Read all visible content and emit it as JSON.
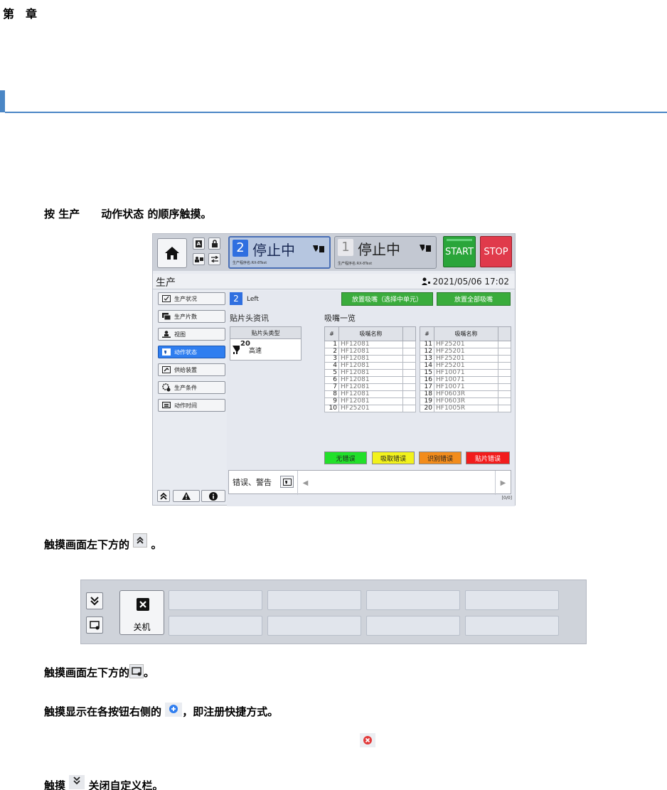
{
  "doc": {
    "chapter_a": "第",
    "chapter_b": "章",
    "step1_a": "按",
    "step1_b": "生产",
    "step1_c": "动作状态",
    "step1_d": "的顺序触摸。",
    "step2_a": "触摸画面左下方的",
    "step2_b": "。",
    "step3_a": "触摸画面左下方的",
    "step3_b": "。",
    "step4_a": "触摸显示在各按钮右侧的",
    "step4_b": "，即注册快捷方式。",
    "step5_a": "触摸",
    "step5_b": "关闭自定义栏。"
  },
  "screen": {
    "lane2_number": "2",
    "lane2_status": "停止中",
    "lane2_program": "生产程序名:RX-8Test",
    "lane1_number": "1",
    "lane1_status": "停止中",
    "lane1_program": "生产程序名:RX-8Test",
    "start_label": "START",
    "stop_label": "STOP",
    "page_title": "生产",
    "clock": "2021/05/06 17:02",
    "sidebar": [
      {
        "label": "生产状况",
        "icon": "checkbox-icon"
      },
      {
        "label": "生产片数",
        "icon": "boards-icon"
      },
      {
        "label": "视图",
        "icon": "person-view-icon"
      },
      {
        "label": "动作状态",
        "icon": "action-status-icon"
      },
      {
        "label": "供给装置",
        "icon": "feeder-icon"
      },
      {
        "label": "生产条件",
        "icon": "gear-icon"
      },
      {
        "label": "动作时间",
        "icon": "timer-icon"
      }
    ],
    "left_badge": "2",
    "left_label": "Left",
    "btn_release_selected": "放置吸嘴（选择中单元）",
    "btn_release_all": "放置全部吸嘴",
    "head_info_title": "贴片头资讯",
    "head_type_header": "贴片头类型",
    "head_type_number": "20",
    "head_type_value": "高速",
    "nozzle_list_title": "吸嘴一览",
    "col_hash": "#",
    "col_name": "吸嘴名称",
    "nozzles_left": [
      {
        "idx": "1",
        "name": "HF12081"
      },
      {
        "idx": "2",
        "name": "HF12081"
      },
      {
        "idx": "3",
        "name": "HF12081"
      },
      {
        "idx": "4",
        "name": "HF12081"
      },
      {
        "idx": "5",
        "name": "HF12081"
      },
      {
        "idx": "6",
        "name": "HF12081"
      },
      {
        "idx": "7",
        "name": "HF12081"
      },
      {
        "idx": "8",
        "name": "HF12081"
      },
      {
        "idx": "9",
        "name": "HF12081"
      },
      {
        "idx": "10",
        "name": "HF25201"
      }
    ],
    "nozzles_right": [
      {
        "idx": "11",
        "name": "HF25201"
      },
      {
        "idx": "12",
        "name": "HF25201"
      },
      {
        "idx": "13",
        "name": "HF25201"
      },
      {
        "idx": "14",
        "name": "HF25201"
      },
      {
        "idx": "15",
        "name": "HF10071"
      },
      {
        "idx": "16",
        "name": "HF10071"
      },
      {
        "idx": "17",
        "name": "HF10071"
      },
      {
        "idx": "18",
        "name": "HF0603R"
      },
      {
        "idx": "19",
        "name": "HF0603R"
      },
      {
        "idx": "20",
        "name": "HF1005R"
      }
    ],
    "legend": [
      {
        "label": "无错误",
        "color": "#22e02a",
        "text": "#000000"
      },
      {
        "label": "吸取错误",
        "color": "#f2f21c",
        "text": "#000000"
      },
      {
        "label": "识别错误",
        "color": "#f28c1c",
        "text": "#000000"
      },
      {
        "label": "贴片错误",
        "color": "#f21c1c",
        "text": "#ffffff"
      }
    ],
    "error_label": "错误、警告",
    "error_counter": "[0/0]"
  },
  "custom_bar": {
    "power_label": "关机"
  },
  "colors": {
    "accent": "#4a86c5",
    "active_blue": "#2f7ef0",
    "start_green": "#2aa53a",
    "stop_red": "#e03a4b"
  }
}
